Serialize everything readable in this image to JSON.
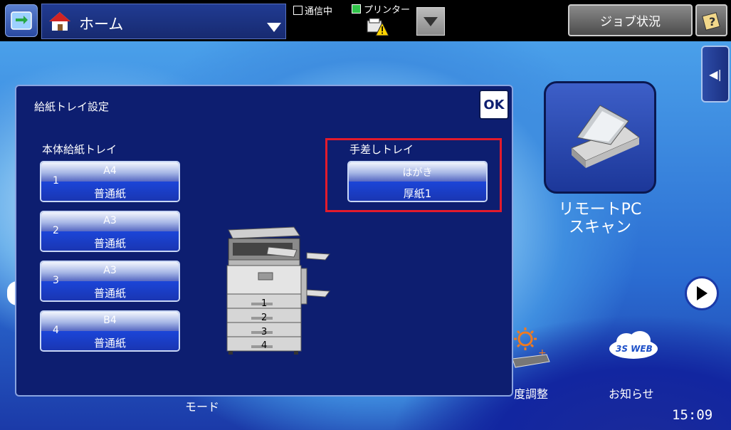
{
  "header": {
    "home_label": "ホーム",
    "status_comm": "通信中",
    "status_printer": "プリンター",
    "job_status_label": "ジョブ状況"
  },
  "background": {
    "remote_pc_label_line1": "リモートPC",
    "remote_pc_label_line2": "スキャン",
    "mode_label": "モード",
    "brightness_label": "度調整",
    "news_label": "お知らせ",
    "web_logo_text": "3S WEB",
    "clock": "15:09"
  },
  "dialog": {
    "title": "給紙トレイ設定",
    "ok_label": "OK",
    "main_trays_label": "本体給紙トレイ",
    "main_trays": [
      {
        "num": "1",
        "size": "A4",
        "type": "普通紙"
      },
      {
        "num": "2",
        "size": "A3",
        "type": "普通紙"
      },
      {
        "num": "3",
        "size": "A3",
        "type": "普通紙"
      },
      {
        "num": "4",
        "size": "B4",
        "type": "普通紙"
      }
    ],
    "bypass_label": "手差しトレイ",
    "bypass": {
      "size": "はがき",
      "type": "厚紙1"
    },
    "copier_tray_numbers": [
      "1",
      "2",
      "3",
      "4"
    ]
  },
  "colors": {
    "highlight": "#e21b2c",
    "dialog_bg": "#0d1e70"
  }
}
